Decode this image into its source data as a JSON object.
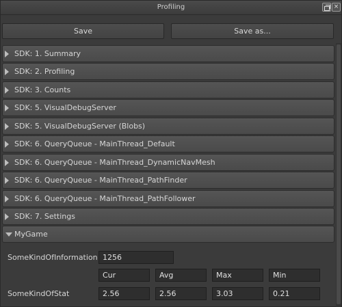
{
  "window": {
    "title": "Profiling",
    "restore_icon": "restore-window-icon",
    "close_label": "×"
  },
  "toolbar": {
    "save_label": "Save",
    "save_as_label": "Save as..."
  },
  "sections": [
    {
      "label": "SDK: 1. Summary",
      "expanded": false
    },
    {
      "label": "SDK: 2. Profiling",
      "expanded": false
    },
    {
      "label": "SDK: 3. Counts",
      "expanded": false
    },
    {
      "label": "SDK: 5. VisualDebugServer",
      "expanded": false
    },
    {
      "label": "SDK: 5. VisualDebugServer (Blobs)",
      "expanded": false
    },
    {
      "label": "SDK: 6. QueryQueue - MainThread_Default",
      "expanded": false
    },
    {
      "label": "SDK: 6. QueryQueue - MainThread_DynamicNavMesh",
      "expanded": false
    },
    {
      "label": "SDK: 6. QueryQueue - MainThread_PathFinder",
      "expanded": false
    },
    {
      "label": "SDK: 6. QueryQueue - MainThread_PathFollower",
      "expanded": false
    },
    {
      "label": "SDK: 7. Settings",
      "expanded": false
    },
    {
      "label": "MyGame",
      "expanded": true
    }
  ],
  "mygame": {
    "info_label": "SomeKindOfInformation",
    "info_value": "1256",
    "stat_label": "SomeKindOfStat",
    "stat_headers": [
      "Cur",
      "Avg",
      "Max",
      "Min"
    ],
    "stat_values": [
      "2.56",
      "2.56",
      "3.03",
      "0.21"
    ]
  }
}
